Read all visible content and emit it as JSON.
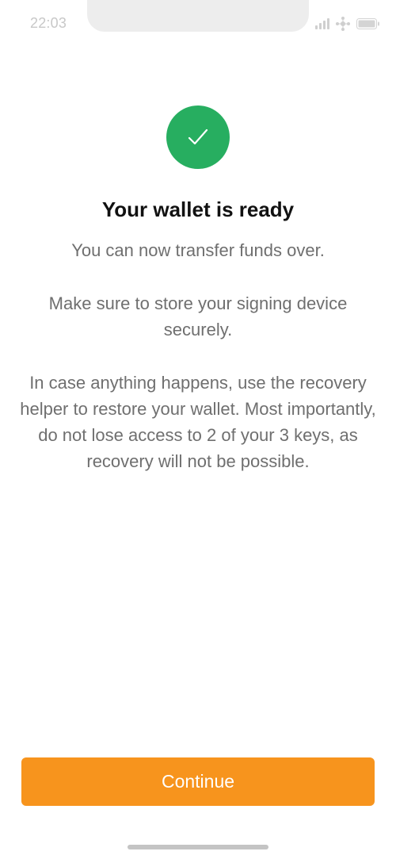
{
  "status_bar": {
    "time": "22:03",
    "icons": [
      "signal-icon",
      "wifi-icon",
      "battery-icon"
    ]
  },
  "success_icon": "checkmark-icon",
  "title": "Your wallet is ready",
  "messages": [
    "You can now transfer funds over.",
    "Make sure to store your signing device securely.",
    "In case anything happens, use the recovery helper to restore your wallet. Most importantly, do not lose access to 2 of your 3 keys, as recovery will not be possible."
  ],
  "continue_button": {
    "label": "Continue"
  },
  "colors": {
    "success": "#27ae60",
    "primary": "#f7941d",
    "title": "#111111",
    "body_text": "#6f6f6f"
  }
}
